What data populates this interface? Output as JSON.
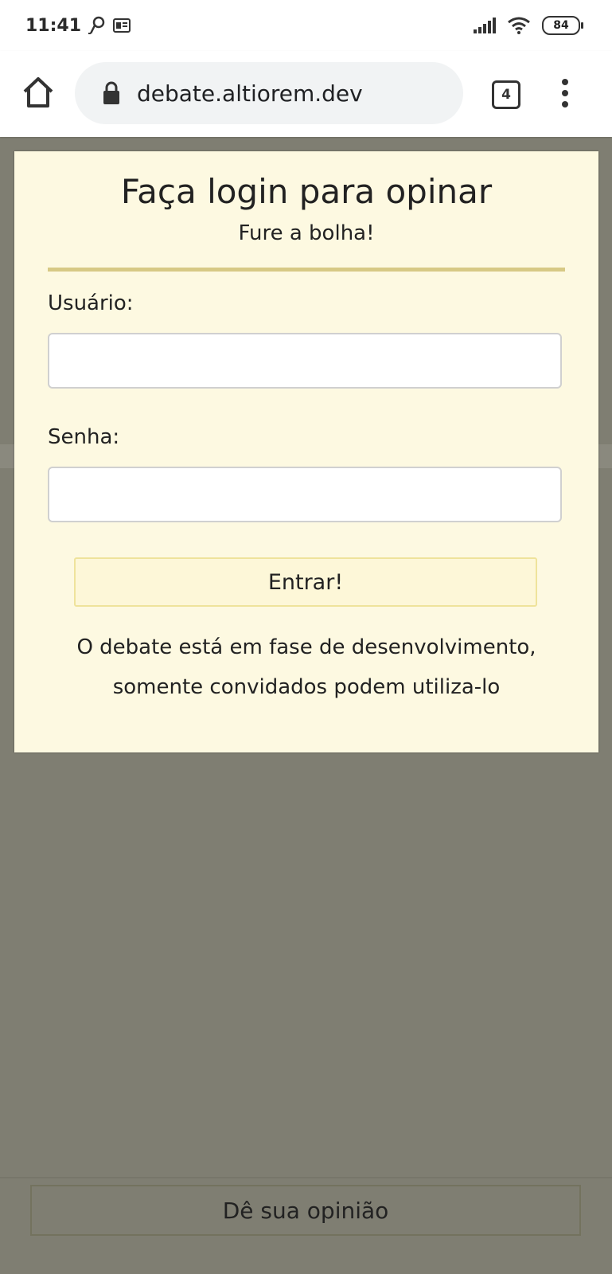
{
  "status_bar": {
    "time": "11:41",
    "battery": "84"
  },
  "browser": {
    "url": "debate.altiorem.dev",
    "tab_count": "4"
  },
  "login_card": {
    "title": "Faça login para opinar",
    "subtitle": "Fure a bolha!",
    "username_label": "Usuário:",
    "username_value": "",
    "password_label": "Senha:",
    "password_value": "",
    "submit_label": "Entrar!",
    "note_line1": "O debate está em fase de desenvolvimento,",
    "note_line2": "somente convidados podem utiliza-lo"
  },
  "bottom": {
    "button_label": "Dê sua opinião"
  },
  "colors": {
    "overlay": "#7f7e72",
    "card_background": "#fdf9e1",
    "divider": "#d7c985",
    "button_border": "#efe39b"
  }
}
